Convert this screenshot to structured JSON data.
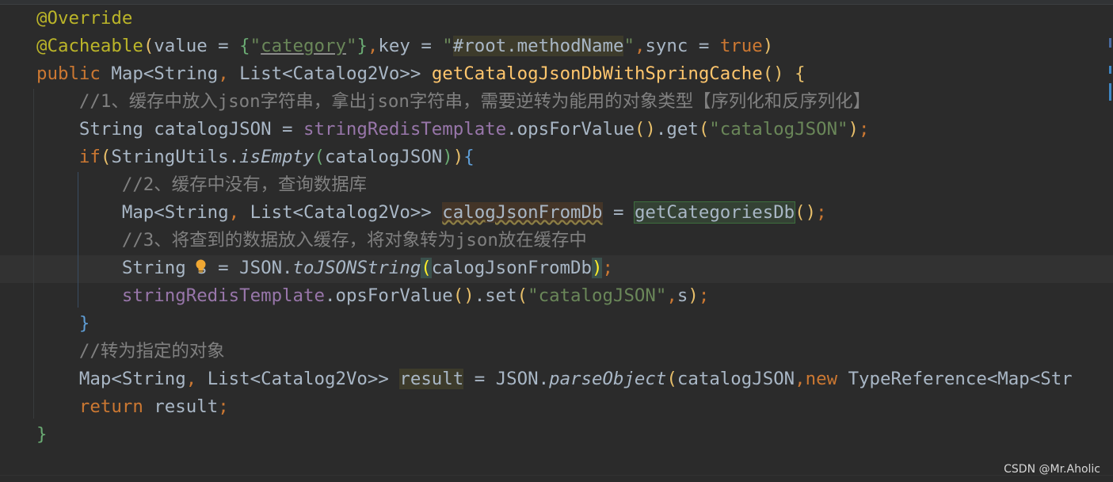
{
  "editor": {
    "lines": [
      [
        {
          "t": "@Override",
          "c": "annotation"
        }
      ],
      [
        {
          "t": "@Cacheable",
          "c": "annotation"
        },
        {
          "t": "(",
          "c": "brace-y"
        },
        {
          "t": "value = ",
          "c": "plain"
        },
        {
          "t": "{",
          "c": "brace-g"
        },
        {
          "t": "\"",
          "c": "string"
        },
        {
          "t": "category",
          "c": "string underline"
        },
        {
          "t": "\"",
          "c": "string"
        },
        {
          "t": "}",
          "c": "brace-g"
        },
        {
          "t": ",",
          "c": "keyword"
        },
        {
          "t": "key = ",
          "c": "plain"
        },
        {
          "t": "\"",
          "c": "string"
        },
        {
          "t": "#root.methodName",
          "c": "plain hl-olive"
        },
        {
          "t": "\"",
          "c": "string"
        },
        {
          "t": ",",
          "c": "keyword"
        },
        {
          "t": "sync = ",
          "c": "plain"
        },
        {
          "t": "true",
          "c": "keyword"
        },
        {
          "t": ")",
          "c": "brace-y"
        }
      ],
      [
        {
          "t": "public ",
          "c": "keyword"
        },
        {
          "t": "Map<String",
          "c": "plain"
        },
        {
          "t": ", ",
          "c": "keyword"
        },
        {
          "t": "List<Catalog2Vo>> ",
          "c": "plain"
        },
        {
          "t": "getCatalogJsonDbWithSpringCache",
          "c": "method"
        },
        {
          "t": "()",
          "c": "brace-y"
        },
        {
          "t": " ",
          "c": "plain"
        },
        {
          "t": "{",
          "c": "brace-y"
        }
      ],
      [
        {
          "t": "    ",
          "c": "plain"
        },
        {
          "t": "//1、缓存中放入json字符串，拿出json字符串，需要逆转为能用的对象类型【序列化和反序列化】",
          "c": "comment"
        }
      ],
      [
        {
          "t": "    String catalogJSON = ",
          "c": "plain"
        },
        {
          "t": "stringRedisTemplate",
          "c": "field"
        },
        {
          "t": ".opsForValue",
          "c": "plain"
        },
        {
          "t": "()",
          "c": "brace-y"
        },
        {
          "t": ".get",
          "c": "plain"
        },
        {
          "t": "(",
          "c": "brace-y"
        },
        {
          "t": "\"catalogJSON\"",
          "c": "string"
        },
        {
          "t": ")",
          "c": "brace-y"
        },
        {
          "t": ";",
          "c": "keyword"
        }
      ],
      [
        {
          "t": "    ",
          "c": "plain"
        },
        {
          "t": "if",
          "c": "keyword"
        },
        {
          "t": "(",
          "c": "brace-y"
        },
        {
          "t": "StringUtils.",
          "c": "plain"
        },
        {
          "t": "isEmpty",
          "c": "plain italic"
        },
        {
          "t": "(",
          "c": "brace-g"
        },
        {
          "t": "catalogJSON",
          "c": "plain"
        },
        {
          "t": ")",
          "c": "brace-g"
        },
        {
          "t": ")",
          "c": "brace-y"
        },
        {
          "t": "{",
          "c": "brace-b"
        }
      ],
      [
        {
          "t": "        ",
          "c": "plain"
        },
        {
          "t": "//2、缓存中没有，查询数据库",
          "c": "comment"
        }
      ],
      [
        {
          "t": "        Map<String",
          "c": "plain"
        },
        {
          "t": ", ",
          "c": "keyword"
        },
        {
          "t": "List<Catalog2Vo>> ",
          "c": "plain"
        },
        {
          "t": "calogJsonFromDb",
          "c": "plain hl-brown squiggle"
        },
        {
          "t": " = ",
          "c": "plain"
        },
        {
          "t": "getCategoriesDb",
          "c": "plain hl-green"
        },
        {
          "t": "()",
          "c": "brace-y"
        },
        {
          "t": ";",
          "c": "keyword"
        }
      ],
      [
        {
          "t": "        ",
          "c": "plain"
        },
        {
          "t": "//3、将查到的数据放入缓存，将对象转为json放在缓存中",
          "c": "comment"
        }
      ],
      [
        {
          "t": "        String s = JSON.",
          "c": "plain"
        },
        {
          "t": "toJSONString",
          "c": "plain italic"
        },
        {
          "t": "(",
          "c": "match-paren"
        },
        {
          "t": "calogJsonFromDb",
          "c": "plain"
        },
        {
          "t": ")",
          "c": "match-paren"
        },
        {
          "t": ";",
          "c": "keyword"
        }
      ],
      [
        {
          "t": "        ",
          "c": "plain"
        },
        {
          "t": "stringRedisTemplate",
          "c": "field"
        },
        {
          "t": ".opsForValue",
          "c": "plain"
        },
        {
          "t": "()",
          "c": "brace-y"
        },
        {
          "t": ".set",
          "c": "plain"
        },
        {
          "t": "(",
          "c": "brace-y"
        },
        {
          "t": "\"catalogJSON\"",
          "c": "string"
        },
        {
          "t": ",",
          "c": "keyword"
        },
        {
          "t": "s",
          "c": "plain"
        },
        {
          "t": ")",
          "c": "brace-y"
        },
        {
          "t": ";",
          "c": "keyword"
        }
      ],
      [
        {
          "t": "    ",
          "c": "plain"
        },
        {
          "t": "}",
          "c": "brace-b"
        }
      ],
      [
        {
          "t": "    ",
          "c": "plain"
        },
        {
          "t": "//转为指定的对象",
          "c": "comment"
        }
      ],
      [
        {
          "t": "    Map<String",
          "c": "plain"
        },
        {
          "t": ", ",
          "c": "keyword"
        },
        {
          "t": "List<Catalog2Vo>> ",
          "c": "plain"
        },
        {
          "t": "result",
          "c": "plain hl-olive"
        },
        {
          "t": " = JSON.",
          "c": "plain"
        },
        {
          "t": "parseObject",
          "c": "plain italic"
        },
        {
          "t": "(",
          "c": "brace-y"
        },
        {
          "t": "catalogJSON",
          "c": "plain"
        },
        {
          "t": ",",
          "c": "keyword"
        },
        {
          "t": "new ",
          "c": "keyword"
        },
        {
          "t": "TypeReference<Map<Str",
          "c": "plain"
        }
      ],
      [
        {
          "t": "    ",
          "c": "plain"
        },
        {
          "t": "return ",
          "c": "keyword"
        },
        {
          "t": "result",
          "c": "plain"
        },
        {
          "t": ";",
          "c": "keyword"
        }
      ],
      [
        {
          "t": "}",
          "c": "brace-g"
        }
      ]
    ],
    "icons": {
      "intention_bulb": "lightbulb-icon"
    }
  },
  "colors": {
    "background": "#2b2b2b",
    "keyword": "#cc7832",
    "string": "#6a8759",
    "method": "#ffc66d",
    "field": "#9876aa",
    "comment": "#808080",
    "annotation": "#bbb529",
    "text": "#a9b7c6"
  },
  "watermark": {
    "text": "CSDN @Mr.Aholic"
  }
}
